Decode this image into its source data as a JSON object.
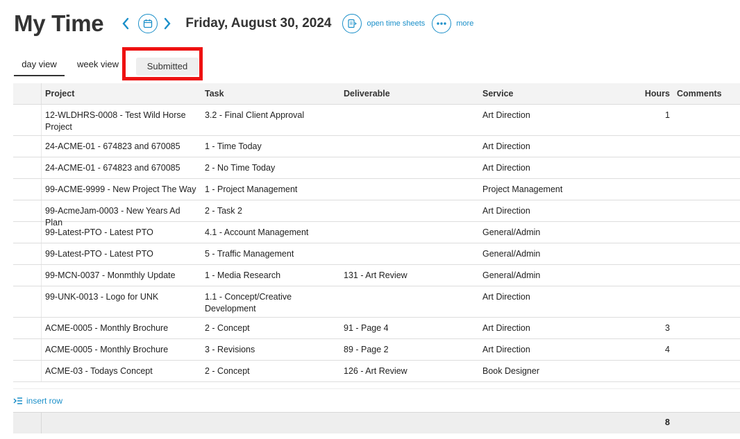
{
  "page": {
    "title": "My Time",
    "date": "Friday, August 30, 2024",
    "open_time_sheets": "open time sheets",
    "more": "more"
  },
  "tabs": {
    "day_view": "day view",
    "week_view": "week view",
    "submitted": "Submitted"
  },
  "table": {
    "headers": {
      "project": "Project",
      "task": "Task",
      "deliverable": "Deliverable",
      "service": "Service",
      "hours": "Hours",
      "comments": "Comments"
    },
    "rows": [
      {
        "project": "12-WLDHRS-0008 - Test Wild Horse Project",
        "task": "3.2 - Final Client Approval",
        "deliverable": "",
        "service": "Art Direction",
        "hours": "1",
        "comments": ""
      },
      {
        "project": "24-ACME-01 - 674823 and 670085",
        "task": "1 - Time Today",
        "deliverable": "",
        "service": "Art Direction",
        "hours": "",
        "comments": ""
      },
      {
        "project": "24-ACME-01 - 674823 and 670085",
        "task": "2 - No Time Today",
        "deliverable": "",
        "service": "Art Direction",
        "hours": "",
        "comments": ""
      },
      {
        "project": "99-ACME-9999 - New Project The Way",
        "task": "1 - Project Management",
        "deliverable": "",
        "service": "Project Management",
        "hours": "",
        "comments": ""
      },
      {
        "project": "99-AcmeJam-0003 - New Years Ad Plan",
        "task": "2 - Task 2",
        "deliverable": "",
        "service": "Art Direction",
        "hours": "",
        "comments": ""
      },
      {
        "project": "99-Latest-PTO - Latest PTO",
        "task": "4.1 - Account Management",
        "deliverable": "",
        "service": "General/Admin",
        "hours": "",
        "comments": ""
      },
      {
        "project": "99-Latest-PTO - Latest PTO",
        "task": "5 - Traffic Management",
        "deliverable": "",
        "service": "General/Admin",
        "hours": "",
        "comments": ""
      },
      {
        "project": "99-MCN-0037 - Monmthly Update",
        "task": "1 - Media Research",
        "deliverable": "131 - Art Review",
        "service": "General/Admin",
        "hours": "",
        "comments": ""
      },
      {
        "project": "99-UNK-0013 - Logo for UNK",
        "task": "1.1 - Concept/Creative Development",
        "deliverable": "",
        "service": "Art Direction",
        "hours": "",
        "comments": ""
      },
      {
        "project": "ACME-0005 - Monthly Brochure",
        "task": "2 - Concept",
        "deliverable": "91 - Page 4",
        "service": "Art Direction",
        "hours": "3",
        "comments": ""
      },
      {
        "project": "ACME-0005 - Monthly Brochure",
        "task": "3 - Revisions",
        "deliverable": "89 - Page 2",
        "service": "Art Direction",
        "hours": "4",
        "comments": ""
      },
      {
        "project": "ACME-03 - Todays Concept",
        "task": "2 - Concept",
        "deliverable": "126 - Art Review",
        "service": "Book Designer",
        "hours": "",
        "comments": ""
      }
    ],
    "insert_row": "insert row",
    "total_hours": "8"
  },
  "icons": {
    "prev": "chevron-left-icon",
    "next": "chevron-right-icon",
    "calendar": "calendar-icon",
    "timesheet": "timesheet-icon",
    "more": "more-dots-icon",
    "insert": "insert-row-icon"
  },
  "colors": {
    "accent": "#1a8fc9",
    "highlight": "#ee1111"
  }
}
